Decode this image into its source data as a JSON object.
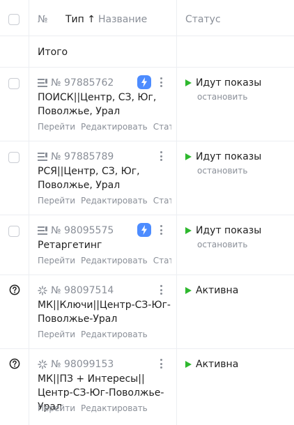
{
  "header": {
    "number_label": "№",
    "type_label": "Тип",
    "sort_arrow": "↑",
    "name_label": "Название",
    "status_label": "Статус"
  },
  "total_label": "Итого",
  "campaigns": [
    {
      "id": "№ 97885762",
      "name": "ПОИСК||Центр, СЗ, Юг, Поволжье, Урал",
      "links": [
        "Перейти",
        "Редактировать",
        "Статистика"
      ],
      "status": "Идут показы",
      "status_action": "остановить",
      "type_icon": "text-ad-icon"
    },
    {
      "id": "№ 97885789",
      "name": "РСЯ||Центр, СЗ, Юг, Поволжье, Урал",
      "links": [
        "Перейти",
        "Редактировать",
        "Статистика"
      ],
      "status": "Идут показы",
      "status_action": "остановить",
      "type_icon": "text-ad-icon"
    },
    {
      "id": "№ 98095575",
      "name": "Ретаргетинг",
      "links": [
        "Перейти",
        "Редактировать",
        "Статистика"
      ],
      "status": "Идут показы",
      "status_action": "остановить",
      "type_icon": "text-ad-icon"
    },
    {
      "id": "№ 98097514",
      "name": "МК||Ключи||Центр-СЗ-Юг-Поволжье-Урал",
      "links": [
        "Перейти",
        "Редактировать"
      ],
      "status": "Активна",
      "type_icon": "master-campaign-icon"
    },
    {
      "id": "№ 98099153",
      "name": "МК||ПЗ + Интересы||Центр-СЗ-Юг-Поволжье-Урал",
      "links": [
        "Перейти",
        "Редактировать"
      ],
      "status": "Активна",
      "type_icon": "master-campaign-icon"
    }
  ],
  "colors": {
    "status_green": "#2eb82e",
    "bolt_blue": "#4d8cff",
    "muted": "#8a8f98",
    "border": "#eceef2"
  }
}
